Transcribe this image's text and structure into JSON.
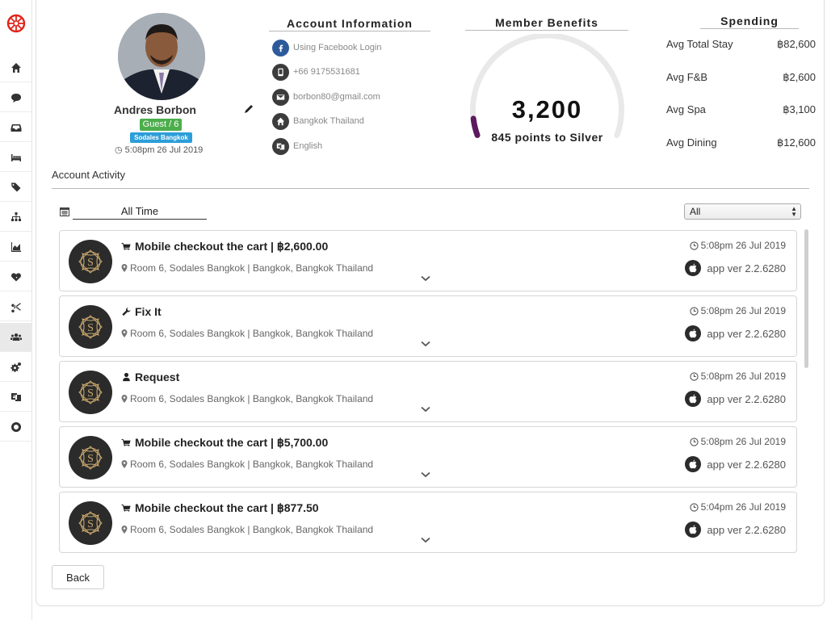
{
  "sidebar": {
    "logo": "wheel-logo",
    "items": [
      {
        "name": "home",
        "icon": "home-icon"
      },
      {
        "name": "messages",
        "icon": "chat-icon"
      },
      {
        "name": "inbox",
        "icon": "inbox-icon"
      },
      {
        "name": "rooms",
        "icon": "bed-icon"
      },
      {
        "name": "tags",
        "icon": "tags-icon"
      },
      {
        "name": "hierarchy",
        "icon": "sitemap-icon"
      },
      {
        "name": "analytics",
        "icon": "area-chart-icon"
      },
      {
        "name": "health",
        "icon": "heartbeat-icon"
      },
      {
        "name": "tools",
        "icon": "scissors-icon"
      },
      {
        "name": "guests",
        "icon": "users-icon",
        "active": true
      },
      {
        "name": "settings",
        "icon": "gears-icon"
      },
      {
        "name": "language",
        "icon": "language-icon"
      },
      {
        "name": "support",
        "icon": "life-ring-icon"
      }
    ]
  },
  "profile": {
    "name": "Andres Borbon",
    "guest_badge": "Guest / 6",
    "hotel_badge": "Sodales Bangkok",
    "timestamp": "5:08pm 26 Jul 2019"
  },
  "account_info": {
    "title": "Account Information",
    "rows": [
      {
        "icon": "facebook-icon",
        "text": "Using Facebook Login"
      },
      {
        "icon": "phone-icon",
        "text": "+66 9175531681"
      },
      {
        "icon": "envelope-icon",
        "text": "borbon80@gmail.com"
      },
      {
        "icon": "home-icon",
        "text": "Bangkok Thailand"
      },
      {
        "icon": "language-icon",
        "text": "English"
      }
    ]
  },
  "benefits": {
    "title": "Member Benefits",
    "points": "3,200",
    "subtitle": "845 points to Silver",
    "progress_fraction": 0.06,
    "progress_color": "#5b1a5e",
    "track_color": "#e9e9e9"
  },
  "spending": {
    "title": "Spending",
    "rows": [
      {
        "label": "Avg Total Stay",
        "value": "฿82,600"
      },
      {
        "label": "Avg F&B",
        "value": "฿2,600"
      },
      {
        "label": "Avg Spa",
        "value": "฿3,100"
      },
      {
        "label": "Avg Dining",
        "value": "฿12,600"
      }
    ]
  },
  "activity": {
    "title": "Account Activity",
    "date_filter": "All Time",
    "type_filter": "All",
    "items": [
      {
        "icon": "cart-icon",
        "title": "Mobile checkout the cart | ฿2,600.00",
        "location": "Room 6, Sodales Bangkok | Bangkok, Bangkok Thailand",
        "time": "5:08pm 26 Jul 2019",
        "app": "app ver 2.2.6280"
      },
      {
        "icon": "wrench-icon",
        "title": "Fix It",
        "location": "Room 6, Sodales Bangkok | Bangkok, Bangkok Thailand",
        "time": "5:08pm 26 Jul 2019",
        "app": "app ver 2.2.6280"
      },
      {
        "icon": "user-icon",
        "title": "Request",
        "location": "Room 6, Sodales Bangkok | Bangkok, Bangkok Thailand",
        "time": "5:08pm 26 Jul 2019",
        "app": "app ver 2.2.6280"
      },
      {
        "icon": "cart-icon",
        "title": "Mobile checkout the cart | ฿5,700.00",
        "location": "Room 6, Sodales Bangkok | Bangkok, Bangkok Thailand",
        "time": "5:08pm 26 Jul 2019",
        "app": "app ver 2.2.6280"
      },
      {
        "icon": "cart-icon",
        "title": "Mobile checkout the cart | ฿877.50",
        "location": "Room 6, Sodales Bangkok | Bangkok, Bangkok Thailand",
        "time": "5:04pm 26 Jul 2019",
        "app": "app ver 2.2.6280"
      }
    ]
  },
  "footer": {
    "back_label": "Back"
  }
}
